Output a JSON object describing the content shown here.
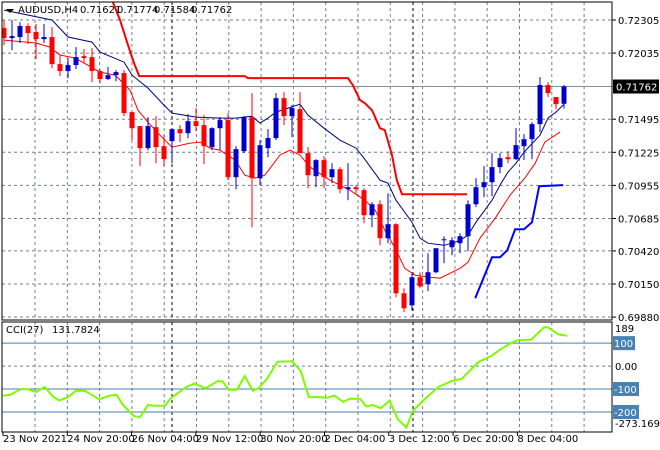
{
  "header": {
    "symbol": "AUDUSD,H4",
    "open": "0.71621",
    "high": "0.71774",
    "low": "0.71584",
    "close": "0.71762"
  },
  "colors": {
    "bull": "#0000cc",
    "bear": "#ff0000",
    "ma_fast": "#000080",
    "ma_slow": "#ff0000",
    "upper_band": "#ff0000",
    "lower_band": "#0000ff",
    "cci": "#7cfc00",
    "level": "#4682b4",
    "grid": "#708090"
  },
  "chart_data": [
    {
      "type": "candlestick",
      "title": "AUDUSD,H4",
      "ylim": [
        0.69856,
        0.72452
      ],
      "y_ticks": [
        "0.72305",
        "0.72035",
        "0.71495",
        "0.71225",
        "0.70955",
        "0.70685",
        "0.70420",
        "0.70150",
        "0.69880"
      ],
      "current_price": "0.71762",
      "x_labels": [
        "23 Nov 2021",
        "24 Nov 20:00",
        "26 Nov 04:00",
        "29 Nov 12:00",
        "30 Nov 20:00",
        "2 Dec 04:00",
        "3 Dec 12:00",
        "6 Dec 20:00",
        "8 Dec 04:00"
      ],
      "ohlc": [
        [
          0.72239,
          0.72305,
          0.721,
          0.72158
        ],
        [
          0.72158,
          0.72305,
          0.72059,
          0.72174
        ],
        [
          0.72166,
          0.72288,
          0.72117,
          0.72256
        ],
        [
          0.72256,
          0.7228,
          0.72109,
          0.72198
        ],
        [
          0.72207,
          0.72272,
          0.71986,
          0.72149
        ],
        [
          0.72149,
          0.72272,
          0.72117,
          0.72166
        ],
        [
          0.72166,
          0.72247,
          0.71912,
          0.71945
        ],
        [
          0.71945,
          0.72019,
          0.71847,
          0.71888
        ],
        [
          0.71888,
          0.71994,
          0.71831,
          0.71937
        ],
        [
          0.71937,
          0.72084,
          0.71904,
          0.72002
        ],
        [
          0.7201,
          0.72068,
          0.71953,
          0.71994
        ],
        [
          0.72002,
          0.72076,
          0.71798,
          0.71888
        ],
        [
          0.71888,
          0.71904,
          0.7179,
          0.71823
        ],
        [
          0.71823,
          0.71921,
          0.71814,
          0.71855
        ],
        [
          0.71855,
          0.71896,
          0.71806,
          0.7188
        ],
        [
          0.71872,
          0.71896,
          0.7152,
          0.71545
        ],
        [
          0.71553,
          0.71553,
          0.71324,
          0.71422
        ],
        [
          0.71439,
          0.71439,
          0.71112,
          0.71259
        ],
        [
          0.71259,
          0.71512,
          0.71242,
          0.71439
        ],
        [
          0.7143,
          0.7152,
          0.71136,
          0.71267
        ],
        [
          0.71275,
          0.71365,
          0.71112,
          0.71169
        ],
        [
          0.71316,
          0.71422,
          0.71136,
          0.71414
        ],
        [
          0.71414,
          0.71447,
          0.71308,
          0.71381
        ],
        [
          0.71381,
          0.71537,
          0.71341,
          0.71479
        ],
        [
          0.71479,
          0.71586,
          0.71398,
          0.71439
        ],
        [
          0.71447,
          0.71528,
          0.71128,
          0.71275
        ],
        [
          0.71267,
          0.7143,
          0.71242,
          0.71422
        ],
        [
          0.71422,
          0.71512,
          0.71242,
          0.71488
        ],
        [
          0.71488,
          0.71545,
          0.70997,
          0.71022
        ],
        [
          0.71022,
          0.71275,
          0.70924,
          0.71251
        ],
        [
          0.71234,
          0.7152,
          0.71218,
          0.71512
        ],
        [
          0.71512,
          0.71708,
          0.70613,
          0.71014
        ],
        [
          0.71014,
          0.71324,
          0.70957,
          0.71283
        ],
        [
          0.71259,
          0.71414,
          0.71185,
          0.71341
        ],
        [
          0.71341,
          0.71708,
          0.71324,
          0.71667
        ],
        [
          0.71667,
          0.71716,
          0.71447,
          0.7152
        ],
        [
          0.7152,
          0.7161,
          0.71349,
          0.71586
        ],
        [
          0.71577,
          0.71716,
          0.71218,
          0.71218
        ],
        [
          0.71218,
          0.71267,
          0.70932,
          0.71038
        ],
        [
          0.7103,
          0.71169,
          0.7094,
          0.71161
        ],
        [
          0.71161,
          0.71193,
          0.70932,
          0.71022
        ],
        [
          0.71022,
          0.71136,
          0.70973,
          0.71087
        ],
        [
          0.71087,
          0.71104,
          0.70891,
          0.70924
        ],
        [
          0.70924,
          0.71136,
          0.70834,
          0.7094
        ],
        [
          0.7094,
          0.70957,
          0.70891,
          0.70924
        ],
        [
          0.70916,
          0.70932,
          0.70646,
          0.70711
        ],
        [
          0.70711,
          0.70818,
          0.70613,
          0.70801
        ],
        [
          0.70801,
          0.70834,
          0.70466,
          0.70524
        ],
        [
          0.70524,
          0.70891,
          0.70483,
          0.70638
        ],
        [
          0.70638,
          0.70646,
          0.70042,
          0.70074
        ],
        [
          0.70074,
          0.70115,
          0.69919,
          0.69952
        ],
        [
          0.69976,
          0.70238,
          0.69935,
          0.70205
        ],
        [
          0.70205,
          0.70246,
          0.70115,
          0.70131
        ],
        [
          0.70148,
          0.70401,
          0.70091,
          0.70246
        ],
        [
          0.70246,
          0.70442,
          0.70238,
          0.70442
        ],
        [
          0.70507,
          0.7054,
          0.70319,
          0.70515
        ],
        [
          0.7045,
          0.70532,
          0.70385,
          0.70507
        ],
        [
          0.70483,
          0.70564,
          0.70401,
          0.7054
        ],
        [
          0.7054,
          0.70834,
          0.70417,
          0.70801
        ],
        [
          0.70801,
          0.71014,
          0.70777,
          0.7094
        ],
        [
          0.7094,
          0.71112,
          0.70859,
          0.70981
        ],
        [
          0.70981,
          0.71218,
          0.70867,
          0.71104
        ],
        [
          0.71104,
          0.71218,
          0.71055,
          0.71177
        ],
        [
          0.71185,
          0.71234,
          0.71136,
          0.71169
        ],
        [
          0.71169,
          0.71422,
          0.71161,
          0.71283
        ],
        [
          0.71275,
          0.71373,
          0.71161,
          0.71332
        ],
        [
          0.71332,
          0.71471,
          0.71169,
          0.71455
        ],
        [
          0.71455,
          0.71839,
          0.7139,
          0.71774
        ],
        [
          0.71774,
          0.71798,
          0.71676,
          0.71708
        ],
        [
          0.71676,
          0.71676,
          0.71577,
          0.71618
        ],
        [
          0.71621,
          0.71774,
          0.71584,
          0.71762
        ]
      ],
      "series": [
        {
          "name": "ma_fast",
          "points": [
            [
              0,
              0.72386
            ],
            [
              6,
              0.72305
            ],
            [
              8,
              0.72166
            ],
            [
              11,
              0.72125
            ],
            [
              12,
              0.72043
            ],
            [
              15,
              0.71961
            ],
            [
              16,
              0.71855
            ],
            [
              18,
              0.71749
            ],
            [
              20,
              0.7161
            ],
            [
              21,
              0.71545
            ],
            [
              24,
              0.71512
            ],
            [
              27,
              0.71504
            ],
            [
              29,
              0.71504
            ],
            [
              31,
              0.7152
            ],
            [
              32,
              0.71463
            ],
            [
              33,
              0.71504
            ],
            [
              34,
              0.71553
            ],
            [
              37,
              0.71618
            ],
            [
              38,
              0.71528
            ],
            [
              40,
              0.71422
            ],
            [
              42,
              0.71324
            ],
            [
              44,
              0.71259
            ],
            [
              45,
              0.71177
            ],
            [
              47,
              0.70997
            ],
            [
              48,
              0.70973
            ],
            [
              49,
              0.70834
            ],
            [
              51,
              0.70654
            ],
            [
              52,
              0.70524
            ],
            [
              53,
              0.70483
            ],
            [
              55,
              0.70466
            ],
            [
              56,
              0.70483
            ],
            [
              57,
              0.70507
            ],
            [
              58,
              0.70548
            ],
            [
              59,
              0.70654
            ],
            [
              61,
              0.70834
            ],
            [
              62,
              0.70957
            ],
            [
              63,
              0.71063
            ],
            [
              64,
              0.71136
            ],
            [
              65,
              0.71226
            ],
            [
              67,
              0.71365
            ],
            [
              68,
              0.71504
            ],
            [
              69,
              0.71553
            ],
            [
              70,
              0.71618
            ]
          ]
        },
        {
          "name": "ma_slow",
          "points": [
            [
              0,
              0.72141
            ],
            [
              4,
              0.72117
            ],
            [
              5.75,
              0.72084
            ],
            [
              7,
              0.72019
            ],
            [
              8.9,
              0.71994
            ],
            [
              12,
              0.7188
            ],
            [
              13.9,
              0.71855
            ],
            [
              15.75,
              0.71733
            ],
            [
              16.75,
              0.71569
            ],
            [
              18,
              0.71471
            ],
            [
              19.5,
              0.71365
            ],
            [
              21,
              0.71267
            ],
            [
              23.25,
              0.713
            ],
            [
              24.5,
              0.71308
            ],
            [
              25.75,
              0.71259
            ],
            [
              27,
              0.71242
            ],
            [
              28.9,
              0.71161
            ],
            [
              30.1,
              0.71038
            ],
            [
              31.4,
              0.71014
            ],
            [
              32.6,
              0.71038
            ],
            [
              34.5,
              0.71202
            ],
            [
              35.75,
              0.71242
            ],
            [
              37,
              0.71202
            ],
            [
              38.25,
              0.71104
            ],
            [
              40.75,
              0.70997
            ],
            [
              43.25,
              0.70916
            ],
            [
              45.1,
              0.70834
            ],
            [
              46.4,
              0.70752
            ],
            [
              47.6,
              0.70589
            ],
            [
              48.9,
              0.70442
            ],
            [
              50.1,
              0.70278
            ],
            [
              51.4,
              0.70221
            ],
            [
              53.25,
              0.70205
            ],
            [
              54.5,
              0.70197
            ],
            [
              57,
              0.70278
            ],
            [
              58,
              0.70327
            ],
            [
              59.5,
              0.70524
            ],
            [
              61.4,
              0.70687
            ],
            [
              63.25,
              0.70875
            ],
            [
              65.1,
              0.71014
            ],
            [
              66.4,
              0.71136
            ],
            [
              67.6,
              0.71308
            ],
            [
              69.5,
              0.7139
            ]
          ]
        },
        {
          "name": "upper_band",
          "points": [
            [
              12.6,
              0.72484
            ],
            [
              13.6,
              0.72452
            ],
            [
              14.5,
              0.72305
            ],
            [
              15.5,
              0.721
            ],
            [
              16.25,
              0.71953
            ],
            [
              16.9,
              0.71847
            ],
            [
              30.1,
              0.71847
            ],
            [
              30.5,
              0.71831
            ],
            [
              43,
              0.71831
            ],
            [
              43.6,
              0.71774
            ],
            [
              44.5,
              0.71651
            ],
            [
              45.1,
              0.71626
            ],
            [
              46,
              0.71569
            ],
            [
              47,
              0.71422
            ],
            [
              47.6,
              0.71406
            ],
            [
              48.5,
              0.71202
            ],
            [
              49.1,
              0.70997
            ],
            [
              49.75,
              0.70883
            ],
            [
              57.9,
              0.70883
            ]
          ]
        },
        {
          "name": "lower_band",
          "points": [
            [
              58.9,
              0.70033
            ],
            [
              61,
              0.70368
            ],
            [
              62,
              0.70368
            ],
            [
              62.9,
              0.70425
            ],
            [
              63.9,
              0.70597
            ],
            [
              65,
              0.70597
            ],
            [
              66,
              0.70654
            ],
            [
              66.9,
              0.70948
            ],
            [
              69.9,
              0.70957
            ]
          ]
        }
      ]
    },
    {
      "type": "line",
      "title": "CCI(27)",
      "current_value": "131.7824",
      "ylim": [
        -287,
        192
      ],
      "levels": [
        100,
        -100,
        -200
      ],
      "y_labels": {
        "max": "189",
        "l100": "100",
        "zero": "0.00",
        "lm100": "-100",
        "lm200": "-200",
        "min": "-273.1698"
      },
      "points": [
        [
          -0.1,
          -129
        ],
        [
          0.8,
          -125
        ],
        [
          2.1,
          -100
        ],
        [
          2.9,
          -100
        ],
        [
          4,
          -113
        ],
        [
          5.1,
          -91
        ],
        [
          6.1,
          -132
        ],
        [
          6.9,
          -150
        ],
        [
          8,
          -135
        ],
        [
          9,
          -107
        ],
        [
          10.1,
          -107
        ],
        [
          11.9,
          -144
        ],
        [
          13.3,
          -128
        ],
        [
          14.1,
          -126
        ],
        [
          14.8,
          -166
        ],
        [
          16.2,
          -217
        ],
        [
          17,
          -223
        ],
        [
          18,
          -169
        ],
        [
          18.8,
          -173
        ],
        [
          20.1,
          -173
        ],
        [
          20.9,
          -139
        ],
        [
          22.8,
          -91
        ],
        [
          23.8,
          -76
        ],
        [
          25.2,
          -97
        ],
        [
          26.7,
          -66
        ],
        [
          27.3,
          -66
        ],
        [
          28.1,
          -103
        ],
        [
          29.1,
          -103
        ],
        [
          30.1,
          -44
        ],
        [
          31.1,
          -107
        ],
        [
          31.8,
          -97
        ],
        [
          32.8,
          -59
        ],
        [
          34.2,
          19
        ],
        [
          36,
          21
        ],
        [
          37.1,
          -22
        ],
        [
          38.1,
          -135
        ],
        [
          39.7,
          -135
        ],
        [
          40.2,
          -139
        ],
        [
          41.3,
          -129
        ],
        [
          42.4,
          -156
        ],
        [
          43.2,
          -142
        ],
        [
          44.5,
          -142
        ],
        [
          45.3,
          -176
        ],
        [
          46.1,
          -169
        ],
        [
          47.1,
          -184
        ],
        [
          48.2,
          -150
        ],
        [
          49.2,
          -230
        ],
        [
          50.3,
          -268
        ],
        [
          51.1,
          -195
        ],
        [
          52.4,
          -150
        ],
        [
          54.3,
          -91
        ],
        [
          56.1,
          -63
        ],
        [
          57.2,
          -56
        ],
        [
          59.3,
          18
        ],
        [
          60.9,
          44
        ],
        [
          61.9,
          69
        ],
        [
          63.5,
          103
        ],
        [
          64.3,
          113
        ],
        [
          65.9,
          115
        ],
        [
          67.5,
          169
        ],
        [
          68,
          169
        ],
        [
          69.3,
          138
        ],
        [
          70.4,
          132
        ]
      ]
    }
  ]
}
